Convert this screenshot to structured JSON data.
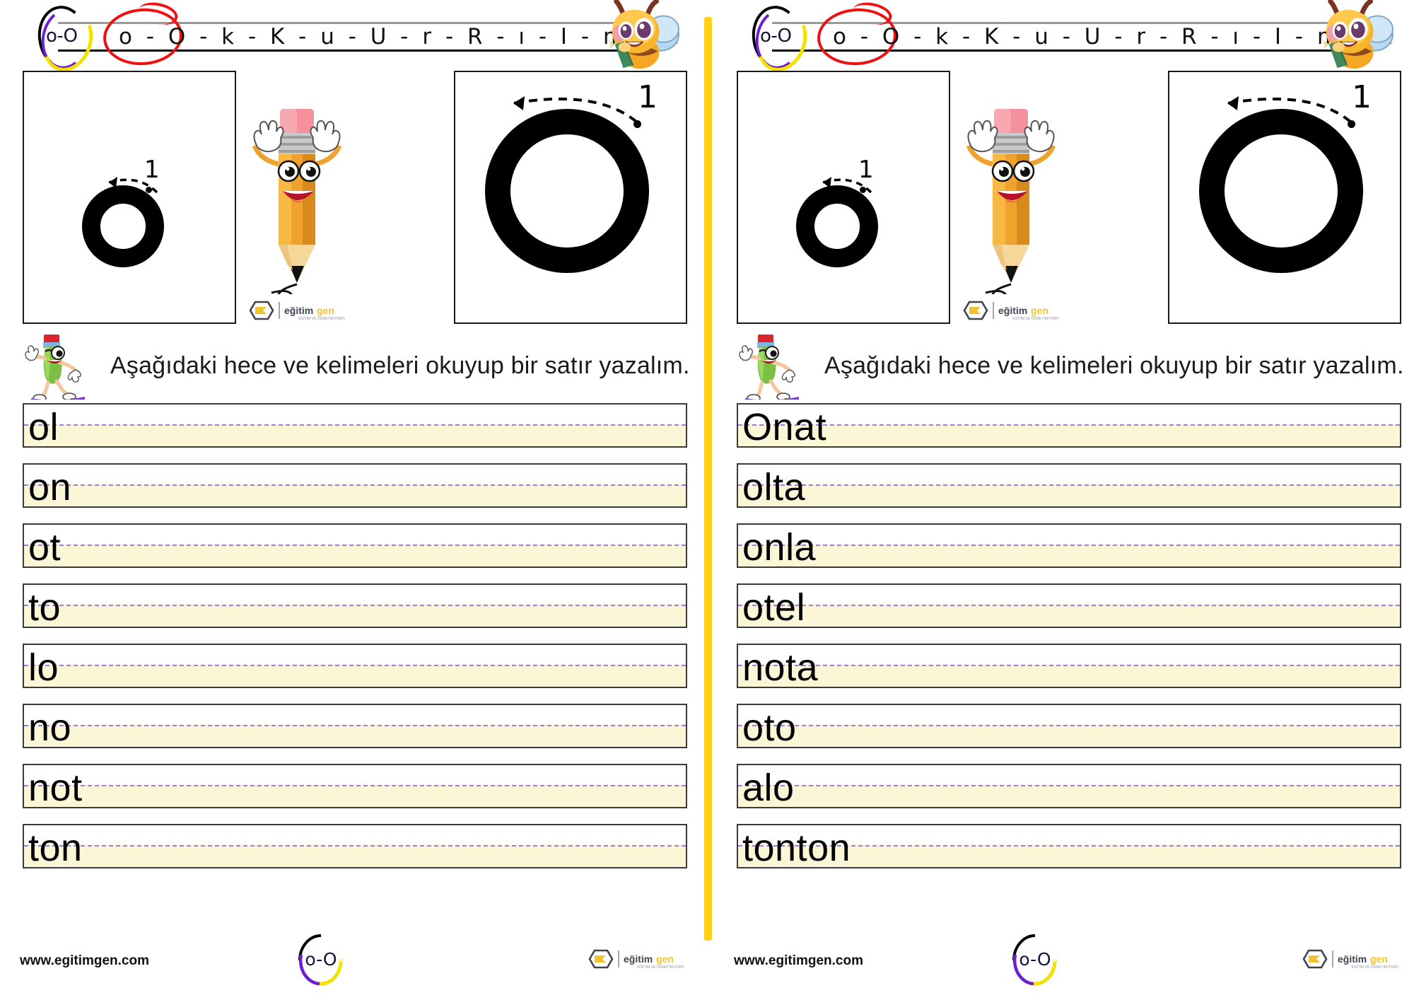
{
  "worksheet": {
    "header": {
      "badge_text": "o-O",
      "letter_sequence": "o - O - k - K - u - U - r - R - ı - I - m - M",
      "circled_pair": "o - O",
      "mascot_icon": "bee-mascot-icon",
      "red_circle_color": "#ee1111"
    },
    "tracing": {
      "small_letter": "o",
      "capital_letter": "O",
      "stroke_number": "1",
      "pencil_icon": "pencil-mascot-icon",
      "brand_logo_text_1": "eğitim",
      "brand_logo_text_2": "gen"
    },
    "instruction": {
      "mascot_icon": "caterpillar-pencil-skateboard-icon",
      "text": "Aşağıdaki hece ve kelimeleri okuyup bir satır yazalım."
    },
    "left_page_words": [
      "ol",
      "on",
      "ot",
      "to",
      "lo",
      "no",
      "not",
      "ton"
    ],
    "right_page_words": [
      "Onat",
      "olta",
      "onla",
      "otel",
      "nota",
      "oto",
      "alo",
      "tonton"
    ],
    "footer": {
      "url": "www.egitimgen.com",
      "badge_text": "o-O",
      "brand_logo_text_1": "eğitim",
      "brand_logo_text_2": "gen"
    },
    "colors": {
      "divider_yellow": "#FFD11A",
      "line_cream": "#fbf6d6",
      "midline_purple": "#9a7fe0",
      "brand_yellow": "#F2C230",
      "brand_dark": "#3d4450"
    }
  }
}
